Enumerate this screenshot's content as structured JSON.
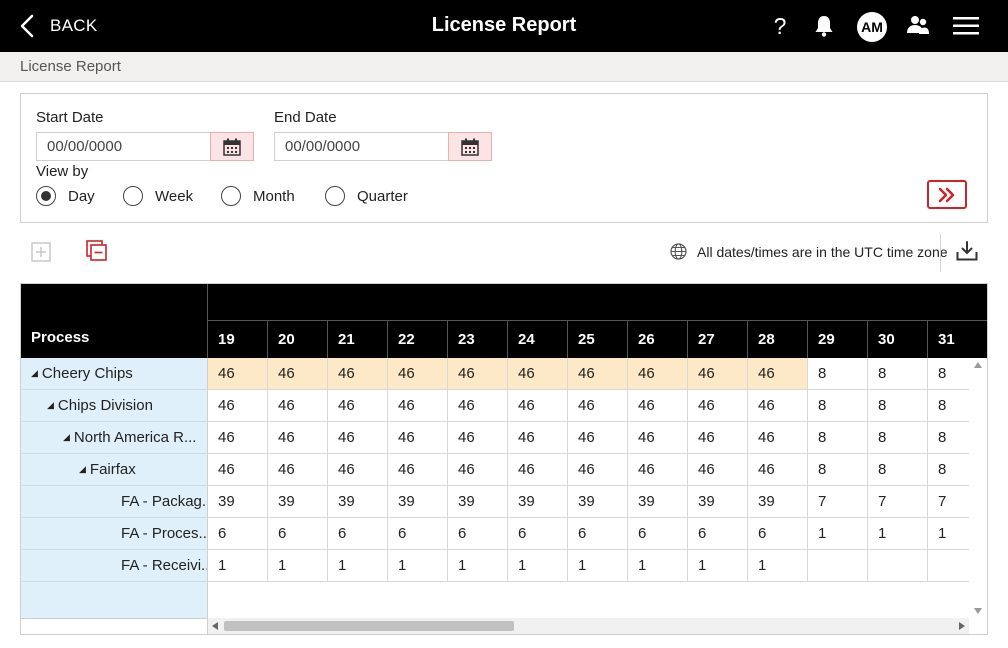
{
  "header": {
    "back_label": "BACK",
    "title": "License Report",
    "help_label": "?",
    "avatar_initials": "AM"
  },
  "breadcrumb": {
    "label": "License Report"
  },
  "filters": {
    "start_label": "Start Date",
    "start_value": "00/00/0000",
    "end_label": "End Date",
    "end_value": "00/00/0000",
    "view_by_label": "View by",
    "options": [
      {
        "label": "Day",
        "selected": true
      },
      {
        "label": "Week",
        "selected": false
      },
      {
        "label": "Month",
        "selected": false
      },
      {
        "label": "Quarter",
        "selected": false
      }
    ]
  },
  "toolbar": {
    "timezone_note": "All dates/times are in the UTC time zone"
  },
  "colors": {
    "accent": "#c8262b",
    "highlight": "#fde9c8",
    "label_bg": "#dff0fa"
  },
  "grid": {
    "first_column_header": "Process",
    "columns": [
      "19",
      "20",
      "21",
      "22",
      "23",
      "24",
      "25",
      "26",
      "27",
      "28",
      "29",
      "30",
      "31"
    ],
    "rows": [
      {
        "label": "Cheery Chips",
        "level": 0,
        "expandable": true,
        "highlight": true,
        "values": [
          "46",
          "46",
          "46",
          "46",
          "46",
          "46",
          "46",
          "46",
          "46",
          "46",
          "8",
          "8",
          "8"
        ]
      },
      {
        "label": "Chips Division",
        "level": 1,
        "expandable": true,
        "highlight": false,
        "values": [
          "46",
          "46",
          "46",
          "46",
          "46",
          "46",
          "46",
          "46",
          "46",
          "46",
          "8",
          "8",
          "8"
        ]
      },
      {
        "label": "North America R...",
        "level": 2,
        "expandable": true,
        "highlight": false,
        "values": [
          "46",
          "46",
          "46",
          "46",
          "46",
          "46",
          "46",
          "46",
          "46",
          "46",
          "8",
          "8",
          "8"
        ]
      },
      {
        "label": "Fairfax",
        "level": 3,
        "expandable": true,
        "highlight": false,
        "values": [
          "46",
          "46",
          "46",
          "46",
          "46",
          "46",
          "46",
          "46",
          "46",
          "46",
          "8",
          "8",
          "8"
        ]
      },
      {
        "label": "FA - Packag...",
        "level": 4,
        "expandable": false,
        "highlight": false,
        "values": [
          "39",
          "39",
          "39",
          "39",
          "39",
          "39",
          "39",
          "39",
          "39",
          "39",
          "7",
          "7",
          "7"
        ]
      },
      {
        "label": "FA - Proces...",
        "level": 4,
        "expandable": false,
        "highlight": false,
        "values": [
          "6",
          "6",
          "6",
          "6",
          "6",
          "6",
          "6",
          "6",
          "6",
          "6",
          "1",
          "1",
          "1"
        ]
      },
      {
        "label": "FA - Receivi...",
        "level": 4,
        "expandable": false,
        "highlight": false,
        "values": [
          "1",
          "1",
          "1",
          "1",
          "1",
          "1",
          "1",
          "1",
          "1",
          "1",
          "",
          "",
          ""
        ]
      }
    ]
  }
}
